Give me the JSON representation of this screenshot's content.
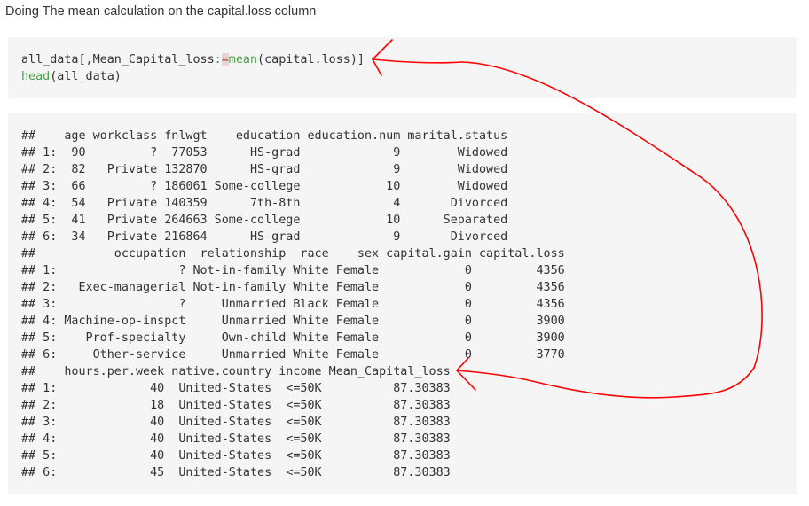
{
  "title": "Doing The mean calculation on the capital.loss column",
  "code": {
    "line1_prefix": "all_data[,Mean_Capital_loss",
    "line1_colon": ":",
    "line1_eq": "=",
    "line1_fn": "mean",
    "line1_suffix": "(capital.loss)]",
    "line2_fn": "head",
    "line2_suffix": "(all_data)"
  },
  "output": {
    "lines": [
      "##    age workclass fnlwgt    education education.num marital.status",
      "## 1:  90         ?  77053      HS-grad             9        Widowed",
      "## 2:  82   Private 132870      HS-grad             9        Widowed",
      "## 3:  66         ? 186061 Some-college            10        Widowed",
      "## 4:  54   Private 140359      7th-8th             4       Divorced",
      "## 5:  41   Private 264663 Some-college            10      Separated",
      "## 6:  34   Private 216864      HS-grad             9       Divorced",
      "##           occupation  relationship  race    sex capital.gain capital.loss",
      "## 1:                 ? Not-in-family White Female            0         4356",
      "## 2:   Exec-managerial Not-in-family White Female            0         4356",
      "## 3:                 ?     Unmarried Black Female            0         4356",
      "## 4: Machine-op-inspct     Unmarried White Female            0         3900",
      "## 5:    Prof-specialty     Own-child White Female            0         3900",
      "## 6:     Other-service     Unmarried White Female            0         3770",
      "##    hours.per.week native.country income Mean_Capital_loss",
      "## 1:             40  United-States  <=50K          87.30383",
      "## 2:             18  United-States  <=50K          87.30383",
      "## 3:             40  United-States  <=50K          87.30383",
      "## 4:             40  United-States  <=50K          87.30383",
      "## 5:             40  United-States  <=50K          87.30383",
      "## 6:             45  United-States  <=50K          87.30383"
    ]
  },
  "colors": {
    "annotation": "#ff0000",
    "block_bg": "#f5f5f5"
  }
}
